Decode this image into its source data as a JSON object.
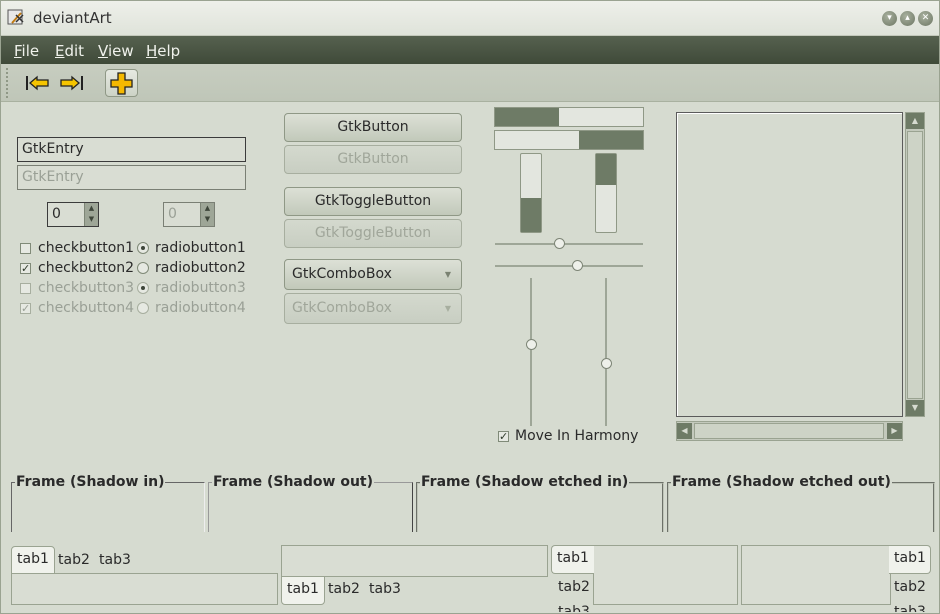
{
  "window": {
    "title": "deviantArt",
    "controls": [
      "minimize",
      "maximize",
      "close"
    ]
  },
  "menubar": {
    "items": [
      {
        "label": "File",
        "mnemonic": "F",
        "rest": "ile"
      },
      {
        "label": "Edit",
        "mnemonic": "E",
        "rest": "dit"
      },
      {
        "label": "View",
        "mnemonic": "V",
        "rest": "iew"
      },
      {
        "label": "Help",
        "mnemonic": "H",
        "rest": "elp"
      }
    ]
  },
  "toolbar": {
    "icons": [
      "goto-first-icon",
      "goto-last-icon",
      "add-icon"
    ]
  },
  "entries": [
    {
      "value": "GtkEntry",
      "sensitive": true
    },
    {
      "value": "GtkEntry",
      "sensitive": false
    }
  ],
  "spinbuttons": [
    {
      "value": "0",
      "sensitive": true
    },
    {
      "value": "0",
      "sensitive": false
    }
  ],
  "checkbuttons": [
    {
      "label": "checkbutton1",
      "checked": false,
      "sensitive": true
    },
    {
      "label": "checkbutton2",
      "checked": true,
      "sensitive": true
    },
    {
      "label": "checkbutton3",
      "checked": false,
      "sensitive": false
    },
    {
      "label": "checkbutton4",
      "checked": true,
      "sensitive": false
    }
  ],
  "radiobuttons": [
    {
      "label": "radiobutton1",
      "selected": true,
      "sensitive": true
    },
    {
      "label": "radiobutton2",
      "selected": false,
      "sensitive": true
    },
    {
      "label": "radiobutton3",
      "selected": true,
      "sensitive": false
    },
    {
      "label": "radiobutton4",
      "selected": false,
      "sensitive": false
    }
  ],
  "buttons": {
    "button": "GtkButton",
    "button_insensitive": "GtkButton",
    "toggle": "GtkToggleButton",
    "toggle_insensitive": "GtkToggleButton",
    "combo": "GtkComboBox",
    "combo_insensitive": "GtkComboBox"
  },
  "progress": {
    "horizontal_1": 0.43,
    "horizontal_2_start": 0.57,
    "vertical_1": 0.43,
    "vertical_2": 0.4
  },
  "scales": {
    "h1": 0.44,
    "h2": 0.56,
    "v1": 0.45,
    "v2": 0.58
  },
  "harmony": {
    "label": "Move In Harmony",
    "checked": true
  },
  "frames": [
    {
      "label": "Frame (Shadow in)"
    },
    {
      "label": "Frame (Shadow out)"
    },
    {
      "label": "Frame (Shadow etched in)"
    },
    {
      "label": "Frame (Shadow etched out)"
    }
  ],
  "notebooks": {
    "tabs": [
      "tab1",
      "tab2",
      "tab3"
    ]
  },
  "colors": {
    "background": "#d6dbd0",
    "menubar": "#4a5544",
    "accent": "#6e7b66"
  }
}
